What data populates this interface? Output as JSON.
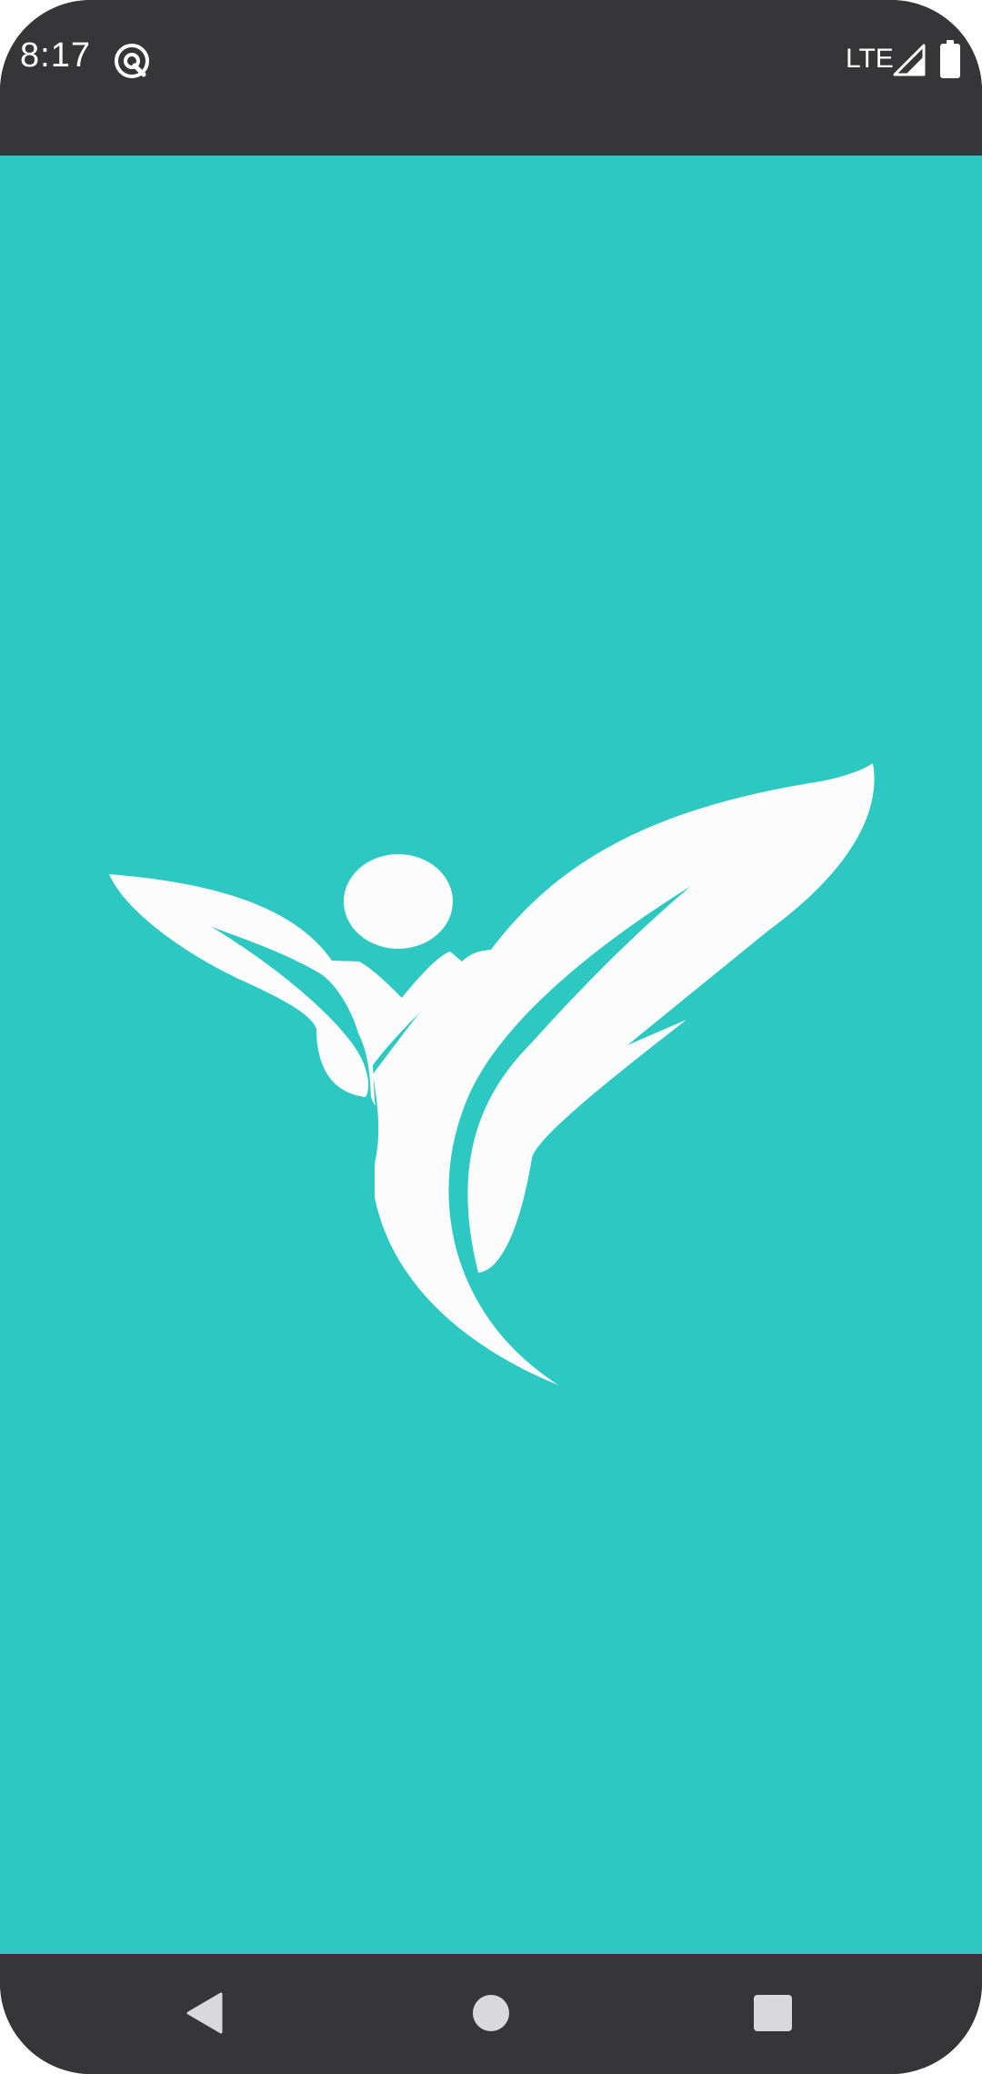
{
  "status_bar": {
    "time": "8:17",
    "network": "LTE",
    "app_icon": "app-notification-icon",
    "signal_icon": "signal-icon",
    "battery_icon": "battery-icon"
  },
  "splash": {
    "background_color": "#2ec8c2",
    "logo": "fitness-figure-logo"
  },
  "navigation_bar": {
    "back": "back-icon",
    "home": "home-icon",
    "recents": "recents-icon"
  }
}
